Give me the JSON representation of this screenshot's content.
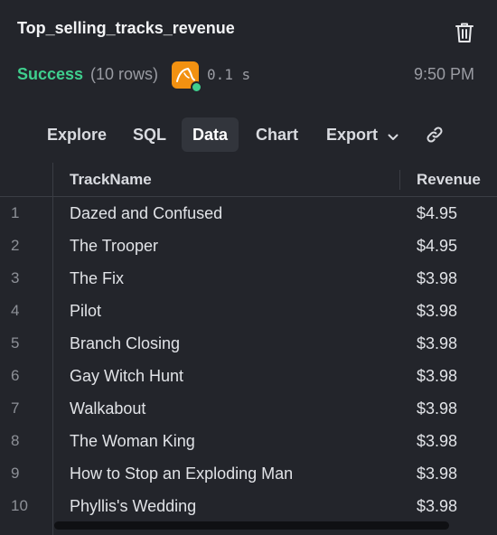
{
  "header": {
    "title": "Top_selling_tracks_revenue",
    "status": "Success",
    "rows_info": "(10 rows)",
    "duration": "0.1 s",
    "time": "9:50 PM"
  },
  "tabs": [
    {
      "label": "Explore"
    },
    {
      "label": "SQL"
    },
    {
      "label": "Data",
      "active": true
    },
    {
      "label": "Chart"
    },
    {
      "label": "Export"
    }
  ],
  "table": {
    "columns": [
      "TrackName",
      "Revenue"
    ],
    "rows": [
      {
        "num": "1",
        "name": "Dazed and Confused",
        "revenue": "$4.95"
      },
      {
        "num": "2",
        "name": "The Trooper",
        "revenue": "$4.95"
      },
      {
        "num": "3",
        "name": "The Fix",
        "revenue": "$3.98"
      },
      {
        "num": "4",
        "name": "Pilot",
        "revenue": "$3.98"
      },
      {
        "num": "5",
        "name": "Branch Closing",
        "revenue": "$3.98"
      },
      {
        "num": "6",
        "name": "Gay Witch Hunt",
        "revenue": "$3.98"
      },
      {
        "num": "7",
        "name": "Walkabout",
        "revenue": "$3.98"
      },
      {
        "num": "8",
        "name": "The Woman King",
        "revenue": "$3.98"
      },
      {
        "num": "9",
        "name": "How to Stop an Exploding Man",
        "revenue": "$3.98"
      },
      {
        "num": "10",
        "name": "Phyllis's Wedding",
        "revenue": "$3.98"
      }
    ]
  },
  "icons": {
    "trash": "trash-icon",
    "database": "mysql-icon",
    "link": "link-icon",
    "chevron": "chevron-down-icon"
  },
  "colors": {
    "background": "#23252b",
    "success": "#3fcf8e",
    "db_icon": "#f29111",
    "active_tab": "#32353c"
  }
}
